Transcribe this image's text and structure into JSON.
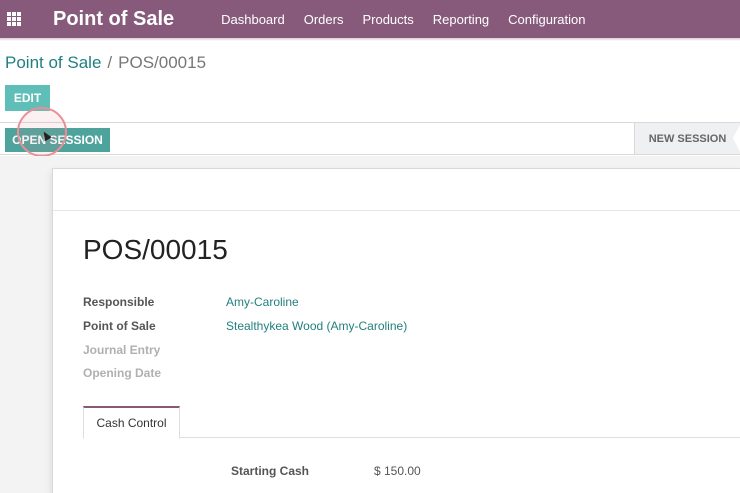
{
  "app": {
    "title": "Point of Sale",
    "menu": [
      "Dashboard",
      "Orders",
      "Products",
      "Reporting",
      "Configuration"
    ]
  },
  "breadcrumb": {
    "parent": "Point of Sale",
    "separator": "/",
    "current": "POS/00015"
  },
  "toolbar": {
    "edit_label": "EDIT"
  },
  "status": {
    "open_session_label": "OPEN SESSION",
    "stage_label": "NEW SESSION"
  },
  "record": {
    "title": "POS/00015",
    "fields": [
      {
        "label": "Responsible",
        "value": "Amy-Caroline"
      },
      {
        "label": "Point of Sale",
        "value": "Stealthykea Wood (Amy-Caroline)"
      },
      {
        "label": "Journal Entry",
        "value": ""
      },
      {
        "label": "Opening Date",
        "value": ""
      }
    ]
  },
  "tabs": [
    {
      "label": "Cash Control"
    }
  ],
  "cash_control": {
    "starting_cash_label": "Starting Cash",
    "starting_cash_value": "$ 150.00"
  },
  "colors": {
    "brand": "#875a7b",
    "accent": "#21807f",
    "button": "#5fbfb8"
  },
  "icons": {
    "apps": "apps-grid-icon"
  }
}
